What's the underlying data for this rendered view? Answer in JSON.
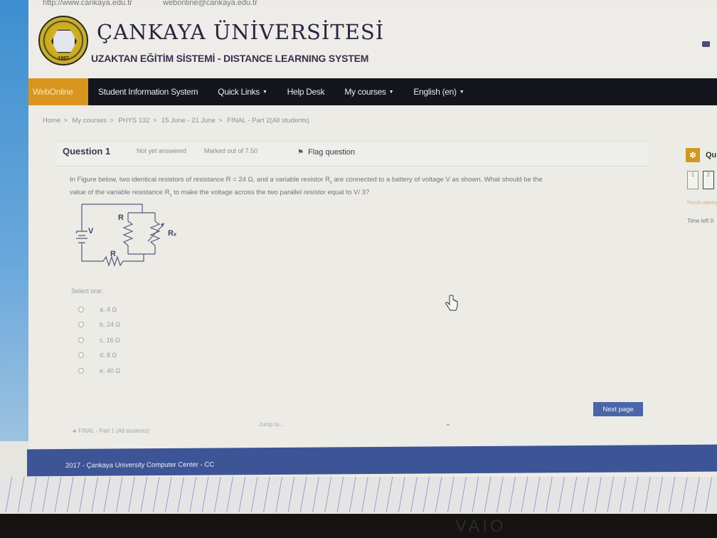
{
  "topbar": {
    "phone": "http://www.cankaya.edu.tr",
    "email": "webonline@cankaya.edu.tr"
  },
  "header": {
    "logo_year": "1997",
    "title": "ÇANKAYA ÜNİVERSİTESİ",
    "subtitle": "UZAKTAN EĞİTİM SİSTEMİ - DISTANCE LEARNING SYSTEM",
    "brand_color": "#d9961e"
  },
  "navbar": {
    "items": [
      {
        "label": "WebOnline",
        "dropdown": false
      },
      {
        "label": "Student Information System",
        "dropdown": false
      },
      {
        "label": "Quick Links",
        "dropdown": true
      },
      {
        "label": "Help Desk",
        "dropdown": false
      },
      {
        "label": "My courses",
        "dropdown": true
      },
      {
        "label": "English (en)",
        "dropdown": true
      }
    ]
  },
  "breadcrumb": [
    "Home",
    "My courses",
    "PHYS 132",
    "15 June - 21 June",
    "FINAL - Part 2(All students)"
  ],
  "question": {
    "title": "Question 1",
    "state": "Not yet answered",
    "mark": "Marked out of 7.50",
    "flag_label": "Flag question",
    "text_line1_a": "In Figure below,  two identical resistors of resistance R = 24 Ω, and a variable resistor R",
    "text_line1_sub": "x",
    "text_line1_b": " are connected to a battery of voltage V as shown. What should be the",
    "text_line2_a": "value of the variable resistance R",
    "text_line2_sub": "x",
    "text_line2_b": " to make the voltage across the two parallel resistor equal to V/ 3?",
    "circuit_labels": {
      "battery": "V",
      "parallel_r": "R",
      "series_r": "R",
      "variable_r": "Rₓ"
    },
    "select_one": "Select one:",
    "answers": [
      {
        "label": "a. 4 Ω",
        "selected": false
      },
      {
        "label": "b. 24 Ω",
        "selected": false
      },
      {
        "label": "c. 16 Ω",
        "selected": false
      },
      {
        "label": "d. 8 Ω",
        "selected": false
      },
      {
        "label": "e. 40 Ω",
        "selected": false
      }
    ]
  },
  "navigation": {
    "next_button": "Next page",
    "prev_link": "◄ FINAL - Part 1 (All students)",
    "jump_to": "Jump to..."
  },
  "quiz_nav": {
    "title": "Qu",
    "buttons": [
      "1",
      "2"
    ],
    "finish": "Finish attempt ...",
    "time_left": "Time left 0"
  },
  "footer": {
    "text": "2017 - Çankaya University Computer Center - CC"
  },
  "bezel_brand": "VAIO"
}
